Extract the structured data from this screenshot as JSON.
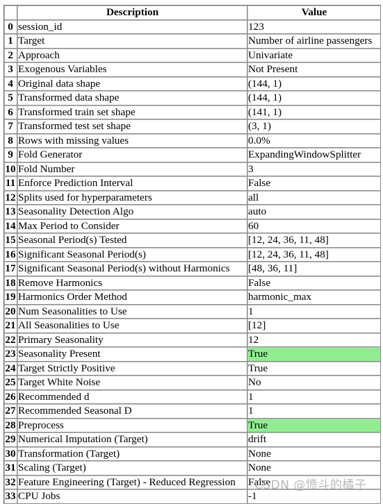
{
  "table": {
    "headers": {
      "index": "",
      "description": "Description",
      "value": "Value"
    },
    "highlight_color": "#90ee90",
    "rows": [
      {
        "index": "0",
        "description": "session_id",
        "value": "123",
        "highlight": false
      },
      {
        "index": "1",
        "description": "Target",
        "value": "Number of airline passengers",
        "highlight": false
      },
      {
        "index": "2",
        "description": "Approach",
        "value": "Univariate",
        "highlight": false
      },
      {
        "index": "3",
        "description": "Exogenous Variables",
        "value": "Not Present",
        "highlight": false
      },
      {
        "index": "4",
        "description": "Original data shape",
        "value": "(144, 1)",
        "highlight": false
      },
      {
        "index": "5",
        "description": "Transformed data shape",
        "value": "(144, 1)",
        "highlight": false
      },
      {
        "index": "6",
        "description": "Transformed train set shape",
        "value": "(141, 1)",
        "highlight": false
      },
      {
        "index": "7",
        "description": "Transformed test set shape",
        "value": "(3, 1)",
        "highlight": false
      },
      {
        "index": "8",
        "description": "Rows with missing values",
        "value": "0.0%",
        "highlight": false
      },
      {
        "index": "9",
        "description": "Fold Generator",
        "value": "ExpandingWindowSplitter",
        "highlight": false
      },
      {
        "index": "10",
        "description": "Fold Number",
        "value": "3",
        "highlight": false
      },
      {
        "index": "11",
        "description": "Enforce Prediction Interval",
        "value": "False",
        "highlight": false
      },
      {
        "index": "12",
        "description": "Splits used for hyperparameters",
        "value": "all",
        "highlight": false
      },
      {
        "index": "13",
        "description": "Seasonality Detection Algo",
        "value": "auto",
        "highlight": false
      },
      {
        "index": "14",
        "description": "Max Period to Consider",
        "value": "60",
        "highlight": false
      },
      {
        "index": "15",
        "description": "Seasonal Period(s) Tested",
        "value": "[12, 24, 36, 11, 48]",
        "highlight": false
      },
      {
        "index": "16",
        "description": "Significant Seasonal Period(s)",
        "value": "[12, 24, 36, 11, 48]",
        "highlight": false
      },
      {
        "index": "17",
        "description": "Significant Seasonal Period(s) without Harmonics",
        "value": "[48, 36, 11]",
        "highlight": false
      },
      {
        "index": "18",
        "description": "Remove Harmonics",
        "value": "False",
        "highlight": false
      },
      {
        "index": "19",
        "description": "Harmonics Order Method",
        "value": "harmonic_max",
        "highlight": false
      },
      {
        "index": "20",
        "description": "Num Seasonalities to Use",
        "value": "1",
        "highlight": false
      },
      {
        "index": "21",
        "description": "All Seasonalities to Use",
        "value": "[12]",
        "highlight": false
      },
      {
        "index": "22",
        "description": "Primary Seasonality",
        "value": "12",
        "highlight": false
      },
      {
        "index": "23",
        "description": "Seasonality Present",
        "value": "True",
        "highlight": true
      },
      {
        "index": "24",
        "description": "Target Strictly Positive",
        "value": "True",
        "highlight": false
      },
      {
        "index": "25",
        "description": "Target White Noise",
        "value": "No",
        "highlight": false
      },
      {
        "index": "26",
        "description": "Recommended d",
        "value": "1",
        "highlight": false
      },
      {
        "index": "27",
        "description": "Recommended Seasonal D",
        "value": "1",
        "highlight": false
      },
      {
        "index": "28",
        "description": "Preprocess",
        "value": "True",
        "highlight": true
      },
      {
        "index": "29",
        "description": "Numerical Imputation (Target)",
        "value": "drift",
        "highlight": false
      },
      {
        "index": "30",
        "description": "Transformation (Target)",
        "value": "None",
        "highlight": false
      },
      {
        "index": "31",
        "description": "Scaling (Target)",
        "value": "None",
        "highlight": false
      },
      {
        "index": "32",
        "description": "Feature Engineering (Target) - Reduced Regression",
        "value": "False",
        "highlight": false
      },
      {
        "index": "33",
        "description": "CPU Jobs",
        "value": "-1",
        "highlight": false
      }
    ]
  },
  "watermark": "CSDN @愤斗的橘子"
}
